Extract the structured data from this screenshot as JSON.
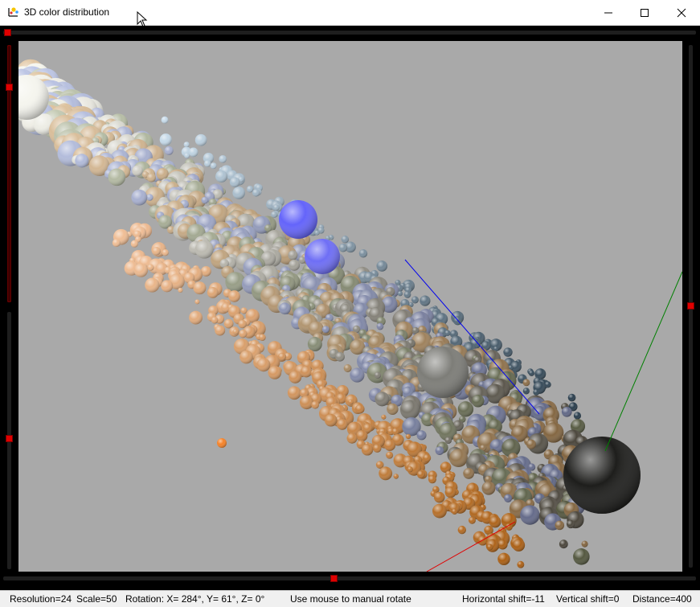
{
  "window": {
    "title": "3D color distribution",
    "app_icon": "axes-icon",
    "minimize_icon": "minimize-icon",
    "maximize_icon": "maximize-icon",
    "close_icon": "close-icon"
  },
  "sliders": {
    "accent_color": "#e00000",
    "top_position": 0.0,
    "bottom_position": 0.48,
    "left_upper_position": 0.17,
    "left_lower_position": 0.49,
    "right_position": 0.5
  },
  "viewport": {
    "background": "#a9a9a9",
    "axis_colors": {
      "x": "#e00000",
      "y": "#008000",
      "z": "#0000ee"
    }
  },
  "status": {
    "resolution": "Resolution=24",
    "scale": "Scale=50",
    "rotation": "Rotation: X= 284°, Y=  61°, Z=   0°",
    "hint": "Use mouse to manual rotate",
    "hshift": "Horizontal shift=-11",
    "vshift": "Vertical shift=0",
    "distance": "Distance=400"
  }
}
